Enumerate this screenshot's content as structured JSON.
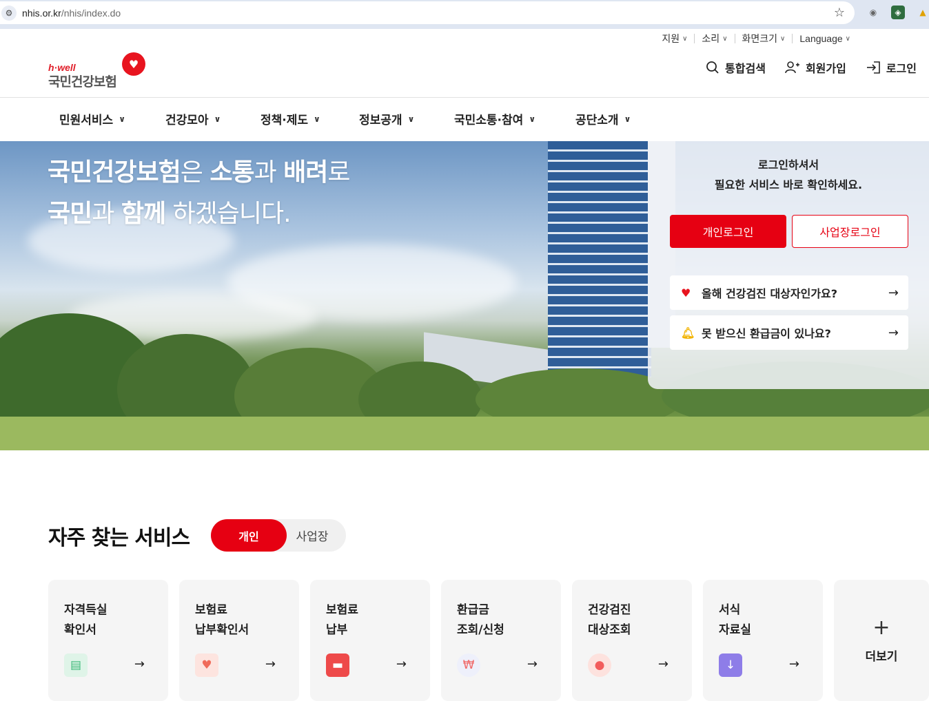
{
  "browser": {
    "url_host": "nhis.or.kr",
    "url_path": "/nhis/index.do",
    "icons": [
      "site-info-icon",
      "bookmark-star-icon",
      "camera-icon",
      "extension-icon",
      "drive-icon"
    ]
  },
  "utility": {
    "items": [
      "지원",
      "소리",
      "화면크기",
      "Language"
    ]
  },
  "logo": {
    "brand": "h·well",
    "name": "국민건강보험"
  },
  "header_actions": {
    "search": "통합검색",
    "signup": "회원가입",
    "login": "로그인"
  },
  "gnb": {
    "items": [
      "민원서비스",
      "건강모아",
      "정책·제도",
      "정보공개",
      "국민소통·참여",
      "공단소개"
    ]
  },
  "hero": {
    "line1_a": "국민건강보험",
    "line1_b": "은 ",
    "line1_c": "소통",
    "line1_d": "과 ",
    "line1_e": "배려",
    "line1_f": "로",
    "line2_a": "국민",
    "line2_b": "과 ",
    "line2_c": "함께",
    "line2_d": " 하겠습니다."
  },
  "login_panel": {
    "title_line1": "로그인하셔서",
    "title_line2": "필요한 서비스 바로 확인하세요.",
    "personal_login": "개인로그인",
    "business_login": "사업장로그인",
    "quick_links": [
      {
        "label": "올해 건강검진 대상자인가요?",
        "icon": "heart-icon"
      },
      {
        "label": "못 받으신 환급금이 있나요?",
        "icon": "bell-icon"
      }
    ]
  },
  "services": {
    "title": "자주 찾는 서비스",
    "tab_personal": "개인",
    "tab_business": "사업장",
    "cards": [
      {
        "line1": "자격득실",
        "line2": "확인서",
        "icon": "document-person-icon",
        "color": "#3cb878"
      },
      {
        "line1": "보험료",
        "line2": "납부확인서",
        "icon": "certificate-icon",
        "color": "#f08a7a"
      },
      {
        "line1": "보험료",
        "line2": "납부",
        "icon": "card-payment-icon",
        "color": "#ee4a4a"
      },
      {
        "line1": "환급금",
        "line2": "조회/신청",
        "icon": "search-money-icon",
        "color": "#f06b6b"
      },
      {
        "line1": "건강검진",
        "line2": "대상조회",
        "icon": "person-search-icon",
        "color": "#f25c5c"
      },
      {
        "line1": "서식",
        "line2": "자료실",
        "icon": "folder-download-icon",
        "color": "#7d6be0"
      }
    ],
    "more": "더보기"
  }
}
